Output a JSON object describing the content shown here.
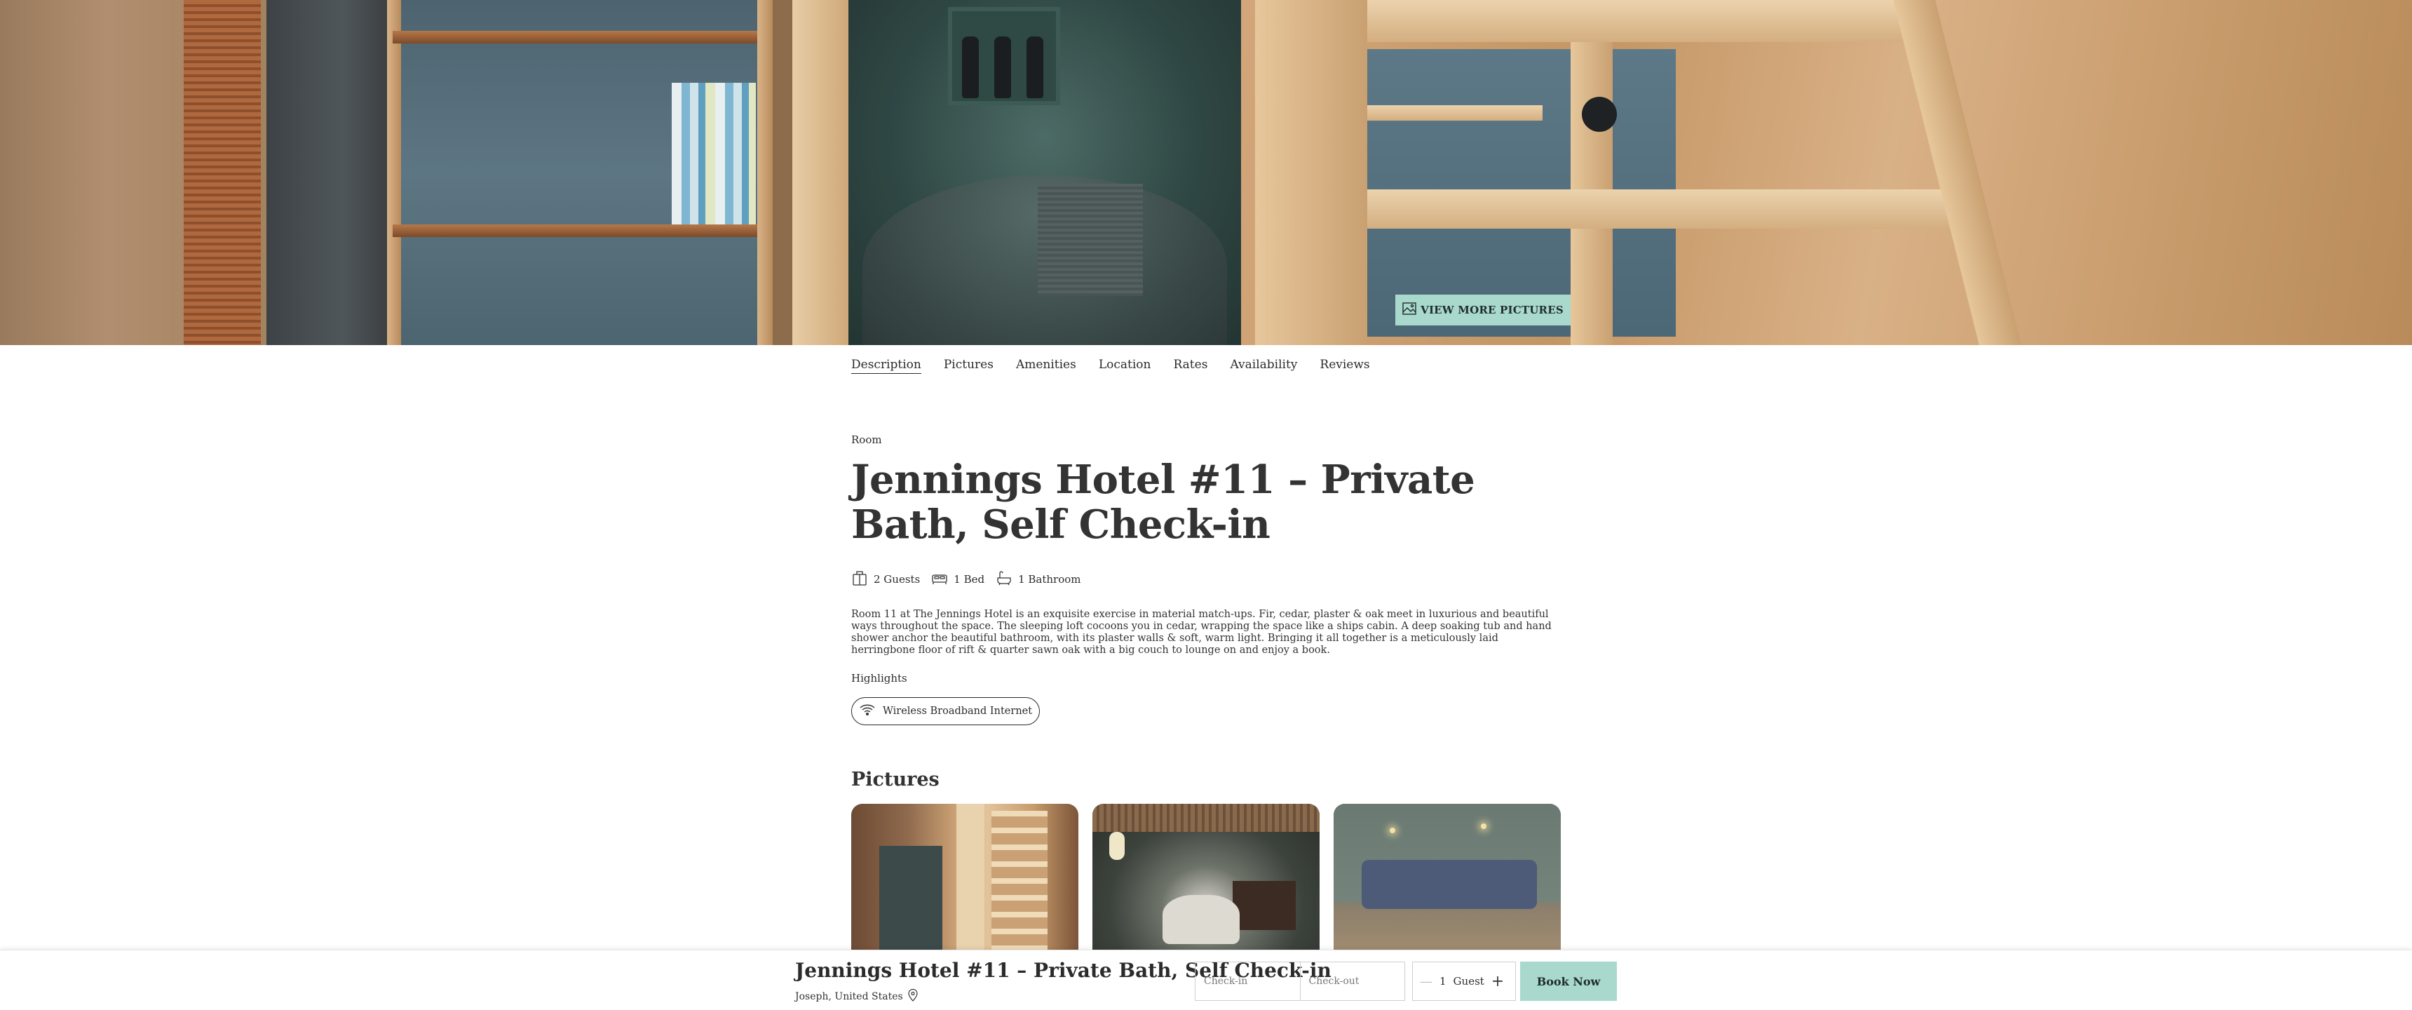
{
  "hero": {
    "view_more_label": "VIEW MORE PICTURES",
    "icon": "image-icon"
  },
  "nav": {
    "tabs": [
      "Description",
      "Pictures",
      "Amenities",
      "Location",
      "Rates",
      "Availability",
      "Reviews"
    ],
    "active": "Description"
  },
  "listing": {
    "eyebrow": "Room",
    "title": "Jennings Hotel #11 – Private Bath, Self Check-in",
    "specs": [
      {
        "icon": "guests-icon",
        "label": "2 Guests"
      },
      {
        "icon": "bed-icon",
        "label": "1 Bed"
      },
      {
        "icon": "bathtub-icon",
        "label": "1 Bathroom"
      }
    ],
    "description": "Room 11 at The Jennings Hotel is an exquisite exercise in material match-ups. Fir, cedar, plaster & oak meet in luxurious and beautiful ways throughout the space. The sleeping loft cocoons you in cedar, wrapping the space like a ships cabin. A deep soaking tub and hand shower anchor the beautiful bathroom, with its plaster walls & soft, warm light. Bringing it all together is a meticulously laid herringbone floor of rift & quarter sawn oak with a big couch to lounge on and enjoy a book.",
    "highlights_label": "Highlights",
    "highlights": [
      {
        "icon": "wifi-icon",
        "label": "Wireless Broadband Internet"
      }
    ]
  },
  "pictures": {
    "heading": "Pictures"
  },
  "booking_bar": {
    "title": "Jennings Hotel #11 – Private Bath, Self Check-in",
    "location": "Joseph, United States",
    "checkin_placeholder": "Check-in",
    "checkout_placeholder": "Check-out",
    "guest_count": "1",
    "guest_label": "Guest",
    "book_label": "Book Now"
  },
  "colors": {
    "accent": "#a9d8cd",
    "text": "#2b2b2b"
  }
}
